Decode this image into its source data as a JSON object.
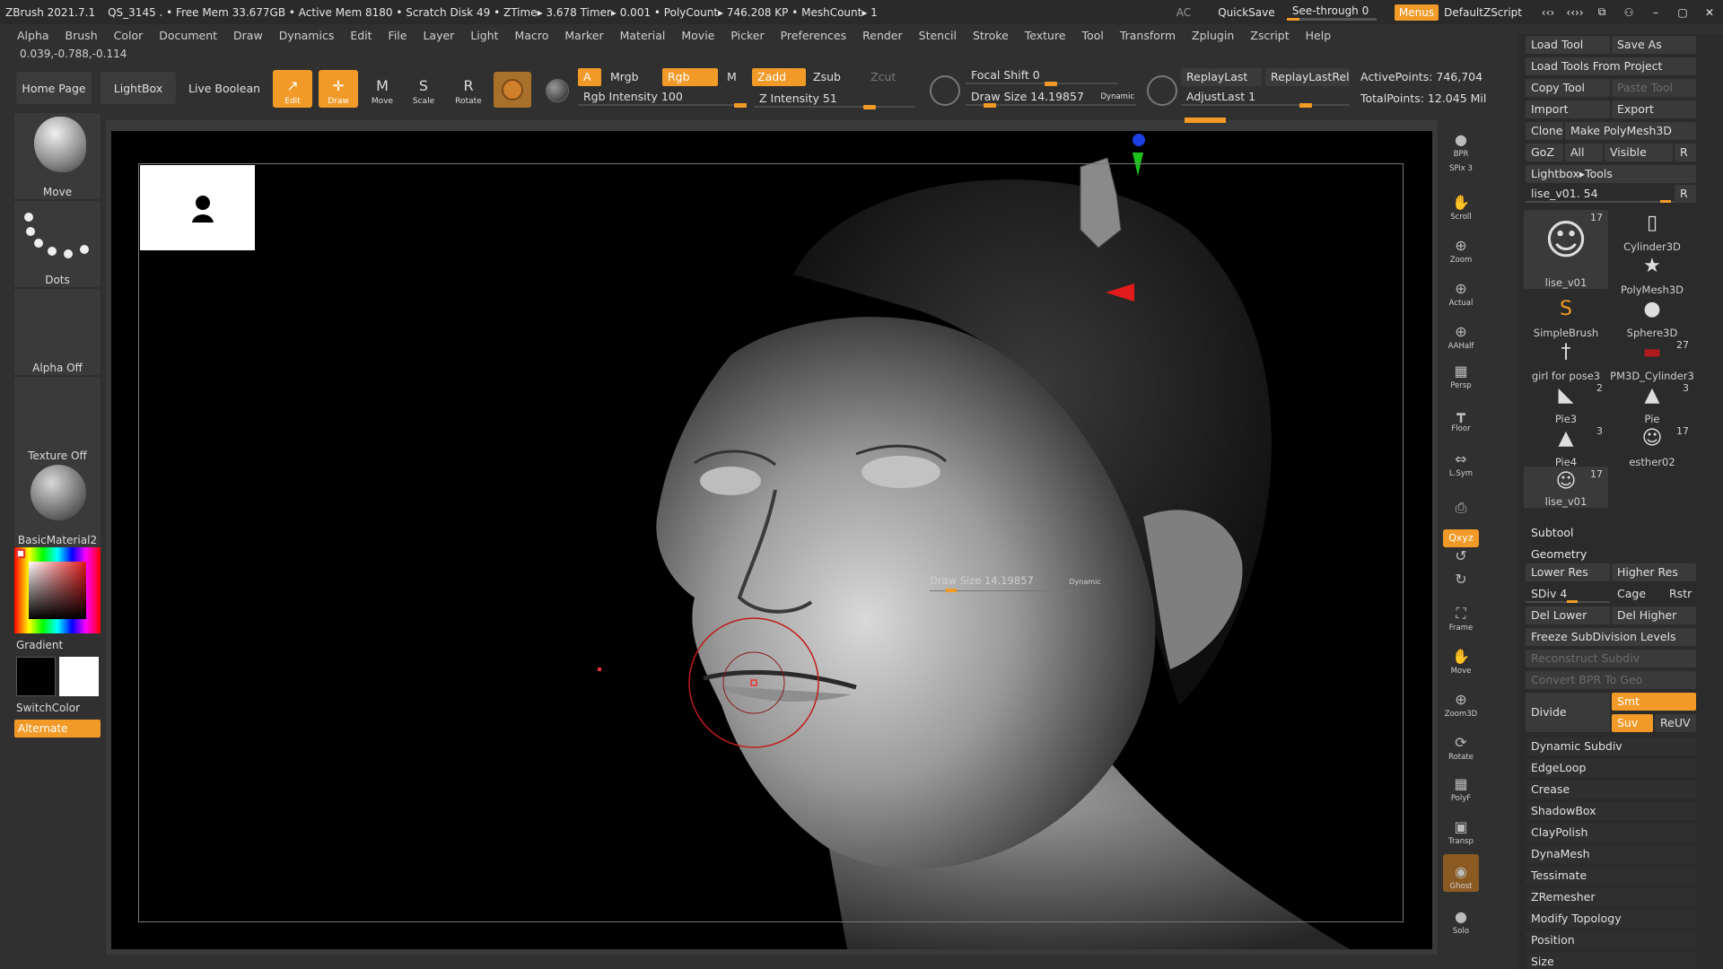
{
  "titlebar": {
    "app": "ZBrush 2021.7.1",
    "stats": "QS_3145   . • Free Mem 33.677GB • Active Mem 8180 • Scratch Disk 49 • ZTime▸ 3.678 Timer▸ 0.001 • PolyCount▸ 746.208 KP • MeshCount▸ 1",
    "ac": "AC",
    "quicksave": "QuickSave",
    "seethrough": "See-through  0",
    "menus": "Menus",
    "default_zscript": "DefaultZScript",
    "win_buttons": [
      "‹‹›",
      "‹‹››",
      "⧉",
      "⚇",
      "–",
      "▢",
      "✕"
    ]
  },
  "menubar": [
    "Alpha",
    "Brush",
    "Color",
    "Document",
    "Draw",
    "Dynamics",
    "Edit",
    "File",
    "Layer",
    "Light",
    "Macro",
    "Marker",
    "Material",
    "Movie",
    "Picker",
    "Preferences",
    "Render",
    "Stencil",
    "Stroke",
    "Texture",
    "Tool",
    "Transform",
    "Zplugin",
    "Zscript",
    "Help"
  ],
  "coords": "0.039,-0.788,-0.114",
  "shelf": {
    "home_page": "Home Page",
    "lightbox": "LightBox",
    "live_boolean": "Live Boolean",
    "tools": [
      {
        "name": "edit",
        "label": "Edit",
        "glyph": "↗",
        "on": true
      },
      {
        "name": "draw",
        "label": "Draw",
        "glyph": "✛",
        "on": true
      },
      {
        "name": "move",
        "label": "Move",
        "glyph": "M",
        "on": false
      },
      {
        "name": "scale",
        "label": "Scale",
        "glyph": "S",
        "on": false
      },
      {
        "name": "rotate",
        "label": "Rotate",
        "glyph": "R",
        "on": false
      }
    ],
    "a_label": "A",
    "mrgb": "Mrgb",
    "rgb": "Rgb",
    "m": "M",
    "rgb_intensity": "Rgb Intensity 100",
    "zadd": "Zadd",
    "zsub": "Zsub",
    "zcut": "Zcut",
    "z_intensity": "Z Intensity 51",
    "focal_shift": "Focal Shift 0",
    "draw_size": "Draw Size 14.19857",
    "dynamic": "Dynamic",
    "replay_last": "ReplayLast",
    "replay_last_rel": "ReplayLastRel",
    "adjust_last": "AdjustLast 1",
    "active_points": "ActivePoints: 746,704",
    "total_points": "TotalPoints: 12.045 Mil"
  },
  "left_tray": {
    "brush": "Move",
    "stroke": "Dots",
    "alpha": "Alpha Off",
    "texture": "Texture Off",
    "material": "BasicMaterial2",
    "gradient": "Gradient",
    "switch_color": "SwitchColor",
    "alternate": "Alternate"
  },
  "canvas": {
    "float_draw_size": "Draw Size 14.19857",
    "float_dynamic": "Dynamic"
  },
  "right_shelf": [
    {
      "name": "bpr",
      "label": "BPR",
      "glyph": "●"
    },
    {
      "name": "spix",
      "label": "SPix 3",
      "glyph": ""
    },
    {
      "name": "scroll",
      "label": "Scroll",
      "glyph": "✋"
    },
    {
      "name": "zoom",
      "label": "Zoom",
      "glyph": "⊕"
    },
    {
      "name": "actual",
      "label": "Actual",
      "glyph": "⊕"
    },
    {
      "name": "aahalf",
      "label": "AAHalf",
      "glyph": "⊕"
    },
    {
      "name": "persp",
      "label": "Persp",
      "glyph": "▦"
    },
    {
      "name": "floor",
      "label": "Floor",
      "glyph": "┳"
    },
    {
      "name": "lsym",
      "label": "L.Sym",
      "glyph": "⇔"
    },
    {
      "name": "lock",
      "label": "",
      "glyph": "⎙"
    },
    {
      "name": "xyz",
      "label": "Qxyz",
      "glyph": ""
    },
    {
      "name": "rot1",
      "label": "",
      "glyph": "↺"
    },
    {
      "name": "rot2",
      "label": "",
      "glyph": "↻"
    },
    {
      "name": "frame",
      "label": "Frame",
      "glyph": "⛶"
    },
    {
      "name": "move",
      "label": "Move",
      "glyph": "✋"
    },
    {
      "name": "zoom3d",
      "label": "Zoom3D",
      "glyph": "⊕"
    },
    {
      "name": "rotate",
      "label": "Rotate",
      "glyph": "⟳"
    },
    {
      "name": "polyf",
      "label": "PolyF",
      "glyph": "▦"
    },
    {
      "name": "transp",
      "label": "Transp",
      "glyph": "▣"
    },
    {
      "name": "ghost",
      "label": "Ghost",
      "glyph": "◉"
    },
    {
      "name": "solo",
      "label": "Solo",
      "glyph": "●"
    }
  ],
  "right_panel": {
    "load_tool": "Load Tool",
    "save_as": "Save As",
    "load_tools_from_project": "Load Tools From Project",
    "copy_tool": "Copy Tool",
    "paste_tool": "Paste Tool",
    "import": "Import",
    "export": "Export",
    "clone": "Clone",
    "make_polymesh": "Make PolyMesh3D",
    "goz": "GoZ",
    "all": "All",
    "visible": "Visible",
    "r": "R",
    "lightbox_tools": "Lightbox▸Tools",
    "current_tool": "lise_v01. 54",
    "tools": [
      {
        "name": "lise_v01",
        "count": "17",
        "icon": "☺"
      },
      {
        "name": "Cylinder3D",
        "count": "",
        "icon": "▯"
      },
      {
        "name": "PolyMesh3D",
        "count": "",
        "icon": "★"
      },
      {
        "name": "SimpleBrush",
        "count": "",
        "icon": "S"
      },
      {
        "name": "Sphere3D",
        "count": "",
        "icon": "●"
      },
      {
        "name": "girl for pose3",
        "count": "",
        "icon": "†"
      },
      {
        "name": "PM3D_Cylinder3",
        "count": "27",
        "icon": "▬"
      },
      {
        "name": "Pie3",
        "count": "2",
        "icon": "◣"
      },
      {
        "name": "Pie",
        "count": "3",
        "icon": "▲"
      },
      {
        "name": "Pie4",
        "count": "3",
        "icon": "▲"
      },
      {
        "name": "esther02",
        "count": "17",
        "icon": "☺"
      },
      {
        "name": "lise_v01",
        "count": "17",
        "icon": "☺"
      }
    ],
    "subtool": "Subtool",
    "geometry": "Geometry",
    "lower_res": "Lower Res",
    "higher_res": "Higher Res",
    "sdiv": "SDiv 4",
    "cage": "Cage",
    "rstr": "Rstr",
    "del_lower": "Del Lower",
    "del_higher": "Del Higher",
    "freeze_subdiv": "Freeze SubDivision Levels",
    "reconstruct_subdiv": "Reconstruct Subdiv",
    "convert_bpr": "Convert BPR To Geo",
    "divide": "Divide",
    "smt": "Smt",
    "suv": "Suv",
    "reuv": "ReUV",
    "rows": [
      "Dynamic Subdiv",
      "EdgeLoop",
      "Crease",
      "ShadowBox",
      "ClayPolish",
      "DynaMesh",
      "Tessimate",
      "ZRemesher",
      "Modify Topology",
      "Position",
      "Size"
    ]
  }
}
